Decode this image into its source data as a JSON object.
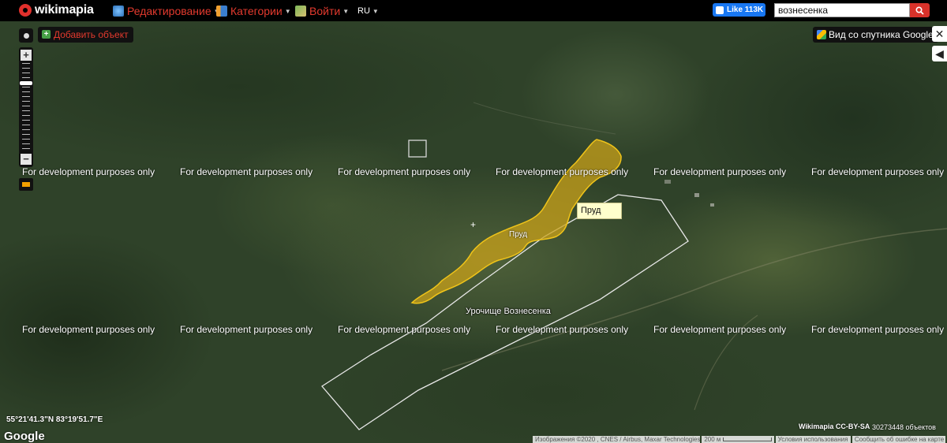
{
  "topbar": {
    "logo": "wikimapia",
    "menu": [
      {
        "label": "Редактирование",
        "icon": "edit-globe-icon"
      },
      {
        "label": "Категории",
        "icon": "categories-icon"
      },
      {
        "label": "Войти",
        "icon": "login-map-icon"
      }
    ],
    "lang": "RU",
    "fb_like": "Like 113K",
    "search_value": "вознесенка"
  },
  "controls": {
    "add_object": "Добавить объект",
    "satellite_view": "Вид со спутника Google"
  },
  "map": {
    "watermark": "For development purposes only",
    "tooltip": "Пруд",
    "pond_label": "Пруд",
    "tract_label": "Урочище Вознесенка",
    "coordinates": "55°21'41.3\"N 83°19'51.7\"E",
    "google_logo": "Google",
    "license": "Wikimapia CC-BY-SA",
    "object_count": "30273448 объектов",
    "colors": {
      "pond_fill": "#c9a21a",
      "pond_stroke": "#f0c419",
      "tract_stroke": "#e8e8e8"
    }
  },
  "footer": {
    "imagery": "Изображения ©2020 , CNES / Airbus, Maxar Technologies",
    "scale": "200 м",
    "terms": "Условия использования",
    "report": "Сообщить об ошибке на карте"
  }
}
